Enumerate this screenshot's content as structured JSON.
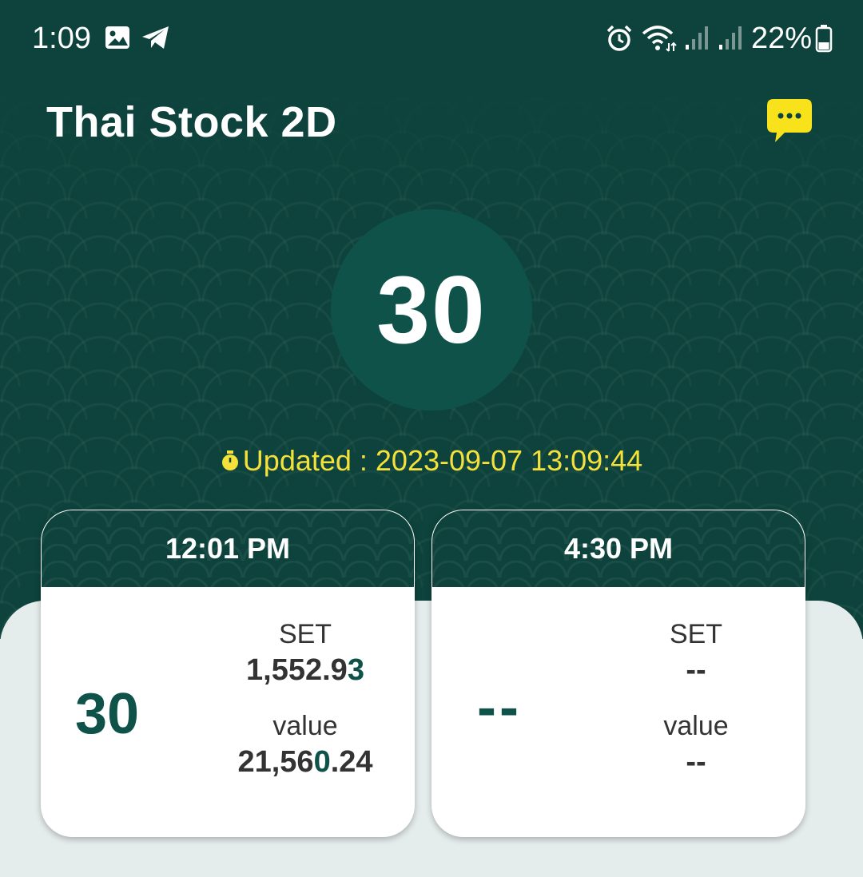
{
  "status_bar": {
    "time": "1:09",
    "battery": "22%"
  },
  "app": {
    "title": "Thai Stock 2D"
  },
  "result": {
    "number": "30"
  },
  "updated": {
    "text": "Updated : 2023-09-07 13:09:44"
  },
  "cards": [
    {
      "time": "12:01 PM",
      "number": "30",
      "set_label": "SET",
      "set_value_prefix": "1,552.9",
      "set_value_highlight": "3",
      "value_label": "value",
      "value_prefix": "21,56",
      "value_highlight": "0",
      "value_suffix": ".24"
    },
    {
      "time": "4:30 PM",
      "number": "--",
      "set_label": "SET",
      "set_value": "--",
      "value_label": "value",
      "value_value": "--"
    }
  ],
  "colors": {
    "primary_dark": "#0d433c",
    "circle": "#0f5249",
    "accent_yellow": "#f4e13a",
    "chat_yellow": "#f7e21b"
  }
}
